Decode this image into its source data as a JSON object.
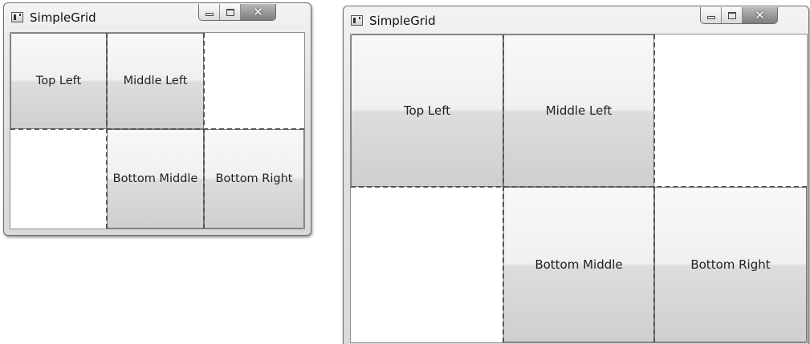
{
  "windows": [
    {
      "title": "SimpleGrid",
      "caption_buttons": {
        "minimize_icon": "minimize-icon",
        "maximize_icon": "maximize-icon",
        "close_glyph": "✕"
      },
      "grid": {
        "rows": 2,
        "columns": 3,
        "show_grid_lines": true
      },
      "buttons": {
        "top_left": "Top Left",
        "middle_left": "Middle Left",
        "bottom_middle": "Bottom Middle",
        "bottom_right": "Bottom Right"
      }
    },
    {
      "title": "SimpleGrid",
      "caption_buttons": {
        "minimize_icon": "minimize-icon",
        "maximize_icon": "maximize-icon",
        "close_glyph": "✕"
      },
      "grid": {
        "rows": 2,
        "columns": 3,
        "show_grid_lines": true
      },
      "buttons": {
        "top_left": "Top Left",
        "middle_left": "Middle Left",
        "bottom_middle": "Bottom Middle",
        "bottom_right": "Bottom Right"
      }
    }
  ]
}
